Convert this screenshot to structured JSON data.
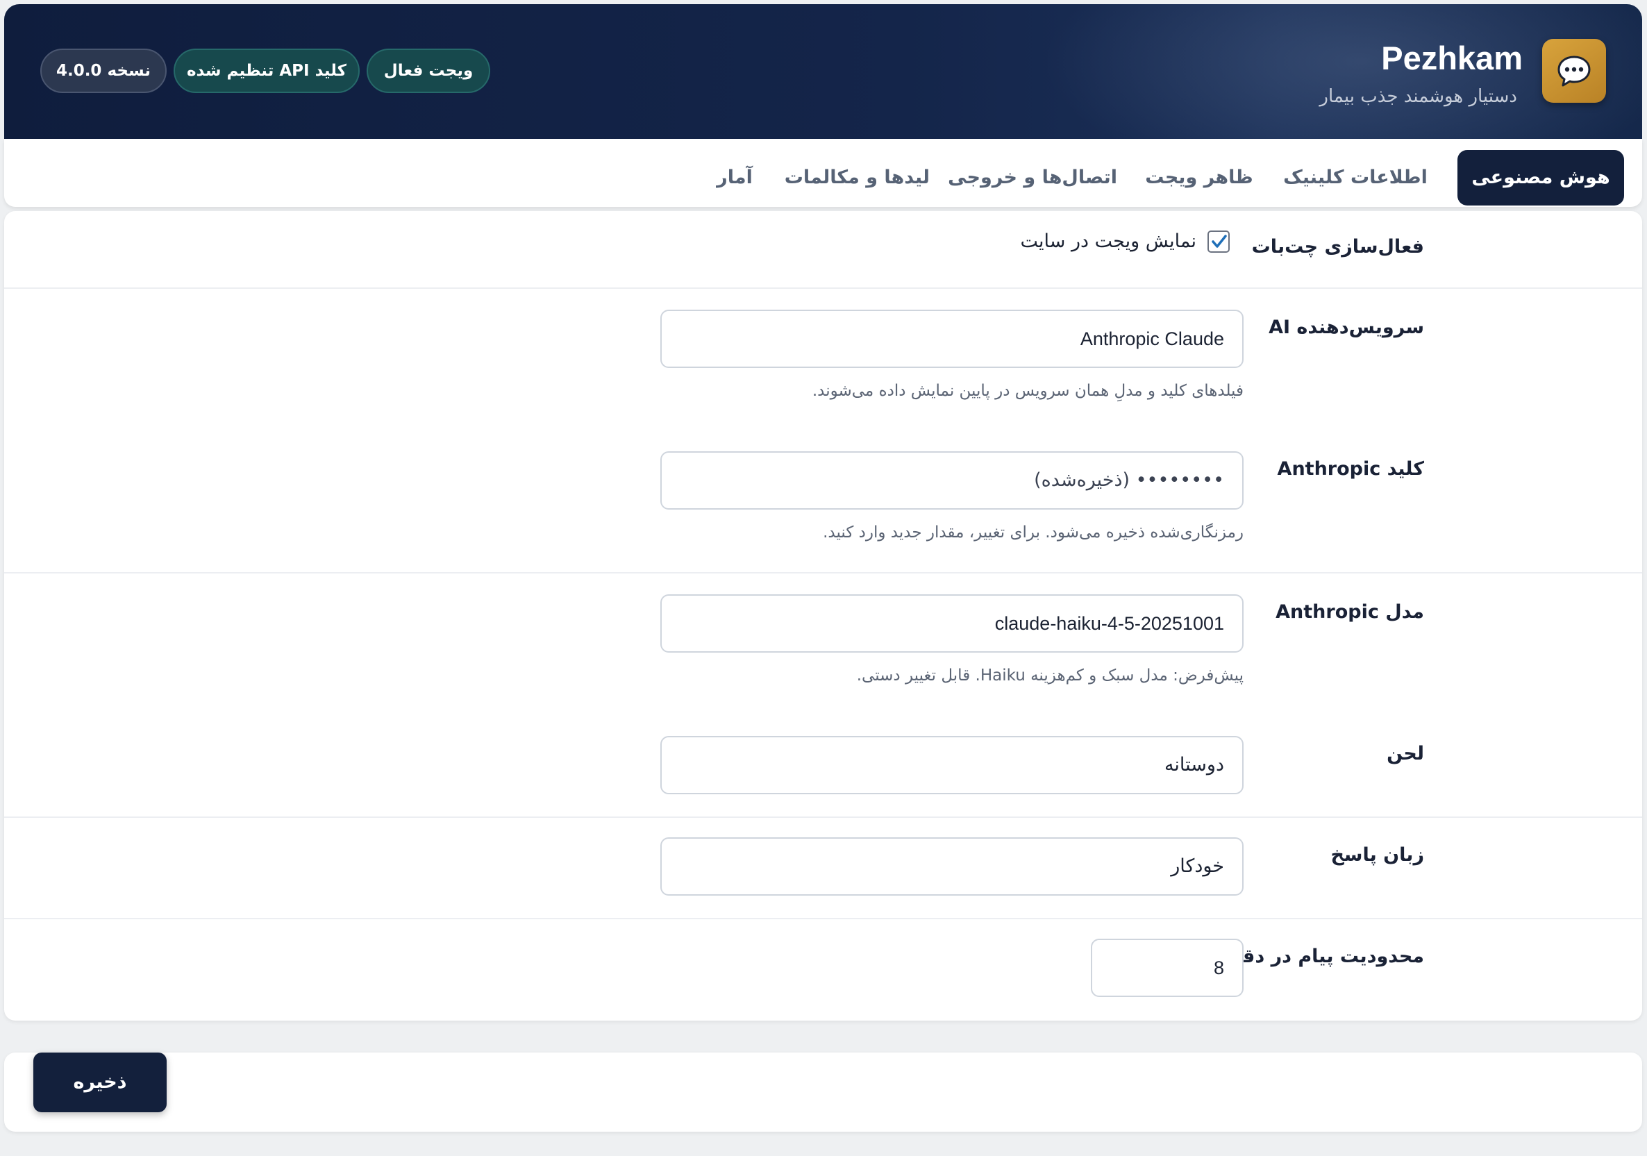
{
  "header": {
    "app_name": "Pezhkam",
    "subtitle": "دستیار هوشمند جذب بیمار",
    "badges": {
      "widget_status": "ویجت فعال",
      "api_status": "کلید API تنظیم شده",
      "version": "نسخه 4.0.0"
    },
    "icon": "chat-bubble-icon"
  },
  "tabs": [
    {
      "label": "هوش مصنوعی",
      "active": true
    },
    {
      "label": "اطلاعات کلینیک",
      "active": false
    },
    {
      "label": "ظاهر ویجت",
      "active": false
    },
    {
      "label": "اتصال‌ها و خروجی",
      "active": false
    },
    {
      "label": "لیدها و مکالمات",
      "active": false
    },
    {
      "label": "آمار",
      "active": false
    }
  ],
  "settings": {
    "chatbot_enable": {
      "label": "فعال‌سازی چت‌بات",
      "checkbox_label": "نمایش ویجت در سایت",
      "checked": true
    },
    "ai_provider": {
      "label": "سرویس‌دهنده AI",
      "value": "Anthropic Claude",
      "help": "فیلدهای کلید و مدلِ همان سرویس در پایین نمایش داده می‌شوند."
    },
    "anthropic_key": {
      "label": "کلید Anthropic",
      "value": "•••••••• (ذخیره‌شده)",
      "help": "رمزنگاری‌شده ذخیره می‌شود. برای تغییر، مقدار جدید وارد کنید."
    },
    "anthropic_model": {
      "label": "مدل Anthropic",
      "value": "claude-haiku-4-5-20251001",
      "help": "پیش‌فرض: مدل سبک و کم‌هزینه Haiku. قابل تغییر دستی."
    },
    "tone": {
      "label": "لحن",
      "value": "دوستانه"
    },
    "response_language": {
      "label": "زبان پاسخ",
      "value": "خودکار"
    },
    "rate_limit": {
      "label": "محدودیت پیام در دقیقه",
      "value": "8"
    }
  },
  "footer": {
    "save_label": "ذخیره"
  },
  "colors": {
    "header_bg": "#14254a",
    "brand_icon": "#c99331",
    "active_tab": "#13203c",
    "badge_green": "#17494d",
    "checkbox_accent": "#1f6fb8"
  }
}
